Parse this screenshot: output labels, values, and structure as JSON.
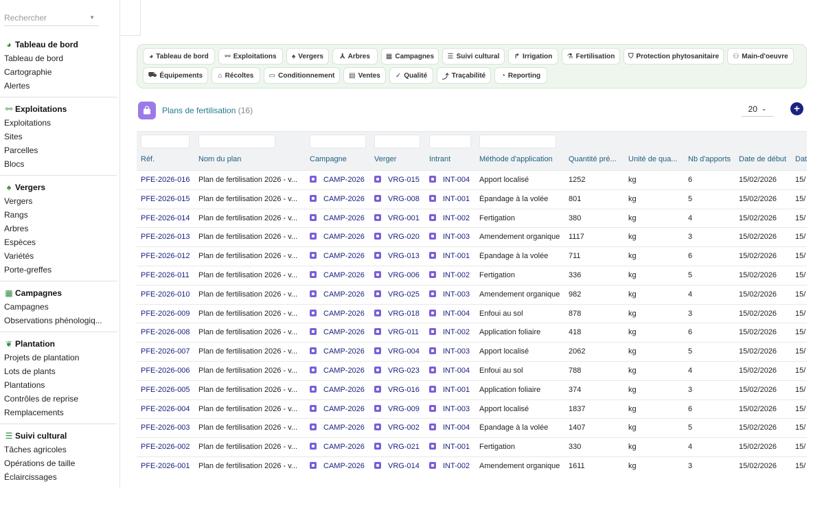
{
  "search": {
    "placeholder": "Rechercher"
  },
  "sidebar": {
    "sections": [
      {
        "title": "Tableau de bord",
        "icon": "dashboard-icon",
        "items": [
          "Tableau de bord",
          "Cartographie",
          "Alertes"
        ]
      },
      {
        "title": "Exploitations",
        "icon": "binoculars-icon",
        "items": [
          "Exploitations",
          "Sites",
          "Parcelles",
          "Blocs"
        ]
      },
      {
        "title": "Vergers",
        "icon": "tree-icon",
        "items": [
          "Vergers",
          "Rangs",
          "Arbres",
          "Espèces",
          "Variétés",
          "Porte-greffes"
        ]
      },
      {
        "title": "Campagnes",
        "icon": "calendar-icon",
        "items": [
          "Campagnes",
          "Observations phénologiq..."
        ]
      },
      {
        "title": "Plantation",
        "icon": "seedling-icon",
        "items": [
          "Projets de plantation",
          "Lots de plants",
          "Plantations",
          "Contrôles de reprise",
          "Remplacements"
        ]
      },
      {
        "title": "Suivi cultural",
        "icon": "list-icon",
        "items": [
          "Tâches agricoles",
          "Opérations de taille",
          "Éclaircissages"
        ]
      }
    ]
  },
  "topnav": {
    "row1": [
      {
        "label": "Tableau de bord",
        "icon": "dashboard-icon"
      },
      {
        "label": "Exploitations",
        "icon": "binoculars-icon"
      },
      {
        "label": "Vergers",
        "icon": "tree-icon"
      },
      {
        "label": "Arbres",
        "icon": "branch-icon"
      },
      {
        "label": "Campagnes",
        "icon": "calendar-icon"
      },
      {
        "label": "Suivi cultural",
        "icon": "list-icon"
      },
      {
        "label": "Irrigation",
        "icon": "faucet-icon"
      },
      {
        "label": "Fertilisation",
        "icon": "flask-icon"
      },
      {
        "label": "Protection phytosanitaire",
        "icon": "shield-icon"
      },
      {
        "label": "Main-d'oeuvre",
        "icon": "users-icon"
      }
    ],
    "row2": [
      {
        "label": "Équipements",
        "icon": "tractor-icon"
      },
      {
        "label": "Récoltes",
        "icon": "basket-icon"
      },
      {
        "label": "Conditionnement",
        "icon": "warehouse-icon"
      },
      {
        "label": "Ventes",
        "icon": "receipt-icon"
      },
      {
        "label": "Qualité",
        "icon": "check-icon"
      },
      {
        "label": "Traçabilité",
        "icon": "route-icon"
      },
      {
        "label": "Reporting",
        "icon": "chart-pie-icon"
      }
    ]
  },
  "page": {
    "title": "Plans de fertilisation",
    "count": "(16)",
    "page_size": "20"
  },
  "table": {
    "columns": [
      "Réf.",
      "Nom du plan",
      "Campagne",
      "Verger",
      "Intrant",
      "Méthode d'application",
      "Quantité pré...",
      "Unité de qua...",
      "Nb d'apports",
      "Date de début",
      "Dat"
    ],
    "rows": [
      [
        "PFE-2026-016",
        "Plan de fertilisation 2026 - v...",
        "CAMP-2026",
        "VRG-015",
        "INT-004",
        "Apport localisé",
        "1252",
        "kg",
        "6",
        "15/02/2026",
        "15/"
      ],
      [
        "PFE-2026-015",
        "Plan de fertilisation 2026 - v...",
        "CAMP-2026",
        "VRG-008",
        "INT-001",
        "Épandage à la volée",
        "801",
        "kg",
        "5",
        "15/02/2026",
        "15/"
      ],
      [
        "PFE-2026-014",
        "Plan de fertilisation 2026 - v...",
        "CAMP-2026",
        "VRG-001",
        "INT-002",
        "Fertigation",
        "380",
        "kg",
        "4",
        "15/02/2026",
        "15/"
      ],
      [
        "PFE-2026-013",
        "Plan de fertilisation 2026 - v...",
        "CAMP-2026",
        "VRG-020",
        "INT-003",
        "Amendement organique",
        "1117",
        "kg",
        "3",
        "15/02/2026",
        "15/"
      ],
      [
        "PFE-2026-012",
        "Plan de fertilisation 2026 - v...",
        "CAMP-2026",
        "VRG-013",
        "INT-001",
        "Épandage à la volée",
        "711",
        "kg",
        "6",
        "15/02/2026",
        "15/"
      ],
      [
        "PFE-2026-011",
        "Plan de fertilisation 2026 - v...",
        "CAMP-2026",
        "VRG-006",
        "INT-002",
        "Fertigation",
        "336",
        "kg",
        "5",
        "15/02/2026",
        "15/"
      ],
      [
        "PFE-2026-010",
        "Plan de fertilisation 2026 - v...",
        "CAMP-2026",
        "VRG-025",
        "INT-003",
        "Amendement organique",
        "982",
        "kg",
        "4",
        "15/02/2026",
        "15/"
      ],
      [
        "PFE-2026-009",
        "Plan de fertilisation 2026 - v...",
        "CAMP-2026",
        "VRG-018",
        "INT-004",
        "Enfoui au sol",
        "878",
        "kg",
        "3",
        "15/02/2026",
        "15/"
      ],
      [
        "PFE-2026-008",
        "Plan de fertilisation 2026 - v...",
        "CAMP-2026",
        "VRG-011",
        "INT-002",
        "Application foliaire",
        "418",
        "kg",
        "6",
        "15/02/2026",
        "15/"
      ],
      [
        "PFE-2026-007",
        "Plan de fertilisation 2026 - v...",
        "CAMP-2026",
        "VRG-004",
        "INT-003",
        "Apport localisé",
        "2062",
        "kg",
        "5",
        "15/02/2026",
        "15/"
      ],
      [
        "PFE-2026-006",
        "Plan de fertilisation 2026 - v...",
        "CAMP-2026",
        "VRG-023",
        "INT-004",
        "Enfoui au sol",
        "788",
        "kg",
        "4",
        "15/02/2026",
        "15/"
      ],
      [
        "PFE-2026-005",
        "Plan de fertilisation 2026 - v...",
        "CAMP-2026",
        "VRG-016",
        "INT-001",
        "Application foliaire",
        "374",
        "kg",
        "3",
        "15/02/2026",
        "15/"
      ],
      [
        "PFE-2026-004",
        "Plan de fertilisation 2026 - v...",
        "CAMP-2026",
        "VRG-009",
        "INT-003",
        "Apport localisé",
        "1837",
        "kg",
        "6",
        "15/02/2026",
        "15/"
      ],
      [
        "PFE-2026-003",
        "Plan de fertilisation 2026 - v...",
        "CAMP-2026",
        "VRG-002",
        "INT-004",
        "Épandage à la volée",
        "1407",
        "kg",
        "5",
        "15/02/2026",
        "15/"
      ],
      [
        "PFE-2026-002",
        "Plan de fertilisation 2026 - v...",
        "CAMP-2026",
        "VRG-021",
        "INT-001",
        "Fertigation",
        "330",
        "kg",
        "4",
        "15/02/2026",
        "15/"
      ],
      [
        "PFE-2026-001",
        "Plan de fertilisation 2026 - v...",
        "CAMP-2026",
        "VRG-014",
        "INT-002",
        "Amendement organique",
        "1611",
        "kg",
        "3",
        "15/02/2026",
        "15/"
      ]
    ]
  },
  "colors": {
    "accent": "#1a237e",
    "brand_green": "#2e8b3e",
    "chip": "#7b5fd8",
    "title": "#1f7a8c"
  }
}
